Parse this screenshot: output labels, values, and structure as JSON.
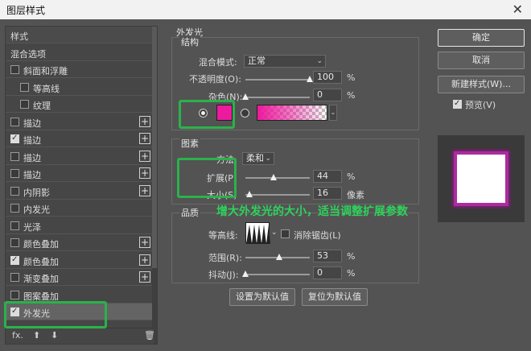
{
  "window": {
    "title": "图层样式",
    "close_glyph": "✕"
  },
  "stylelist": {
    "items": [
      {
        "label": "样式",
        "has_checkbox": false,
        "checked": false,
        "plus": false
      },
      {
        "label": "混合选项",
        "has_checkbox": false,
        "checked": false,
        "plus": false
      },
      {
        "label": "斜面和浮雕",
        "has_checkbox": true,
        "checked": false,
        "plus": false
      },
      {
        "label": "等高线",
        "has_checkbox": true,
        "checked": false,
        "plus": false
      },
      {
        "label": "纹理",
        "has_checkbox": true,
        "checked": false,
        "plus": false
      },
      {
        "label": "描边",
        "has_checkbox": true,
        "checked": false,
        "plus": true
      },
      {
        "label": "描边",
        "has_checkbox": true,
        "checked": true,
        "plus": true
      },
      {
        "label": "描边",
        "has_checkbox": true,
        "checked": false,
        "plus": true
      },
      {
        "label": "描边",
        "has_checkbox": true,
        "checked": false,
        "plus": true
      },
      {
        "label": "内阴影",
        "has_checkbox": true,
        "checked": false,
        "plus": true
      },
      {
        "label": "内发光",
        "has_checkbox": true,
        "checked": false,
        "plus": false
      },
      {
        "label": "光泽",
        "has_checkbox": true,
        "checked": false,
        "plus": false
      },
      {
        "label": "颜色叠加",
        "has_checkbox": true,
        "checked": false,
        "plus": true
      },
      {
        "label": "颜色叠加",
        "has_checkbox": true,
        "checked": true,
        "plus": true
      },
      {
        "label": "渐变叠加",
        "has_checkbox": true,
        "checked": false,
        "plus": true
      },
      {
        "label": "图案叠加",
        "has_checkbox": true,
        "checked": false,
        "plus": false
      },
      {
        "label": "外发光",
        "has_checkbox": true,
        "checked": true,
        "plus": false,
        "selected": true
      }
    ],
    "bottom": {
      "fx": "fx.",
      "up": "⬆",
      "down": "⬇",
      "trash": "🗑"
    }
  },
  "outer_glow": {
    "title": "外发光",
    "structure": {
      "label": "结构",
      "blend_mode_label": "混合模式:",
      "blend_mode_value": "正常",
      "opacity_label": "不透明度(O):",
      "opacity_value": "100",
      "opacity_unit": "%",
      "noise_label": "杂色(N):",
      "noise_value": "0",
      "noise_unit": "%",
      "color_hex": "#ec1a9c"
    },
    "elements": {
      "label": "图素",
      "method_label": "方法:",
      "method_value": "柔和",
      "spread_label": "扩展(P)",
      "spread_value": "44",
      "spread_unit": "%",
      "size_label": "大小(S)",
      "size_value": "16",
      "size_unit": "像素"
    },
    "quality": {
      "label": "品质",
      "contour_label": "等高线:",
      "antialias_label": "消除锯齿(L)",
      "range_label": "范围(R):",
      "range_value": "53",
      "range_unit": "%",
      "jitter_label": "抖动(J):",
      "jitter_value": "0",
      "jitter_unit": "%"
    },
    "buttons": {
      "set_default": "设置为默认值",
      "reset_default": "复位为默认值"
    },
    "annotation": "增大外发光的大小，适当调整扩展参数"
  },
  "sliders": {
    "opacity": 1.0,
    "noise": 0.0,
    "spread": 0.44,
    "size": 0.06,
    "range": 0.53,
    "jitter": 0.0
  },
  "right": {
    "ok": "确定",
    "cancel": "取消",
    "new_style": "新建样式(W)...",
    "preview_label": "预览(V)",
    "preview_checked": true
  },
  "colors": {
    "highlight": "#2ab24b",
    "glow": "#ec1a9c",
    "annotation": "#2ed35c"
  }
}
